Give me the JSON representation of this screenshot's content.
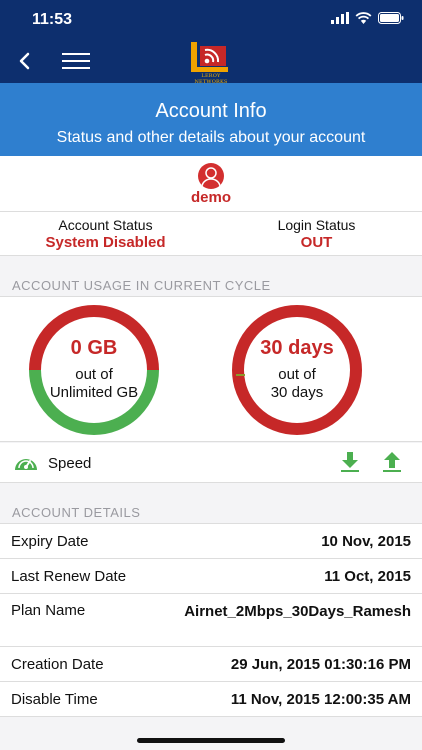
{
  "status_bar": {
    "time": "11:53",
    "icons": [
      "signal-icon",
      "wifi-icon",
      "battery-icon"
    ]
  },
  "nav": {
    "logo_text": "LEROY NETWORKS",
    "icons": [
      "back-arrow-icon",
      "hamburger-menu-icon"
    ]
  },
  "banner": {
    "title": "Account Info",
    "subtitle": "Status and other details about your account"
  },
  "user": {
    "name": "demo",
    "icon": "user-avatar-icon"
  },
  "status": {
    "account_label": "Account Status",
    "account_value": "System Disabled",
    "login_label": "Login Status",
    "login_value": "OUT"
  },
  "usage": {
    "header": "ACCOUNT USAGE IN CURRENT CYCLE",
    "data": {
      "value": "0 GB",
      "line1": "out of",
      "line2": "Unlimited GB",
      "used_fraction": 0
    },
    "days": {
      "value": "30 days",
      "line1": "out of",
      "line2": "30 days",
      "used_fraction": 1.0
    }
  },
  "speed": {
    "label": "Speed",
    "icons": [
      "speedometer-icon",
      "download-icon",
      "upload-icon"
    ]
  },
  "details": {
    "header": "ACCOUNT DETAILS",
    "rows": [
      {
        "label": "Expiry Date",
        "value": "10 Nov, 2015"
      },
      {
        "label": "Last Renew Date",
        "value": "11 Oct, 2015"
      },
      {
        "label": "Plan Name",
        "value": "Airnet_2Mbps_30Days_Ramesh"
      },
      {
        "label": "Creation Date",
        "value": "29 Jun, 2015 01:30:16 PM"
      },
      {
        "label": "Disable Time",
        "value": "11 Nov, 2015 12:00:35 AM"
      }
    ]
  },
  "colors": {
    "navy": "#0d2f6e",
    "banner_blue": "#2f7fcf",
    "red": "#c62828",
    "green": "#4caf50"
  }
}
